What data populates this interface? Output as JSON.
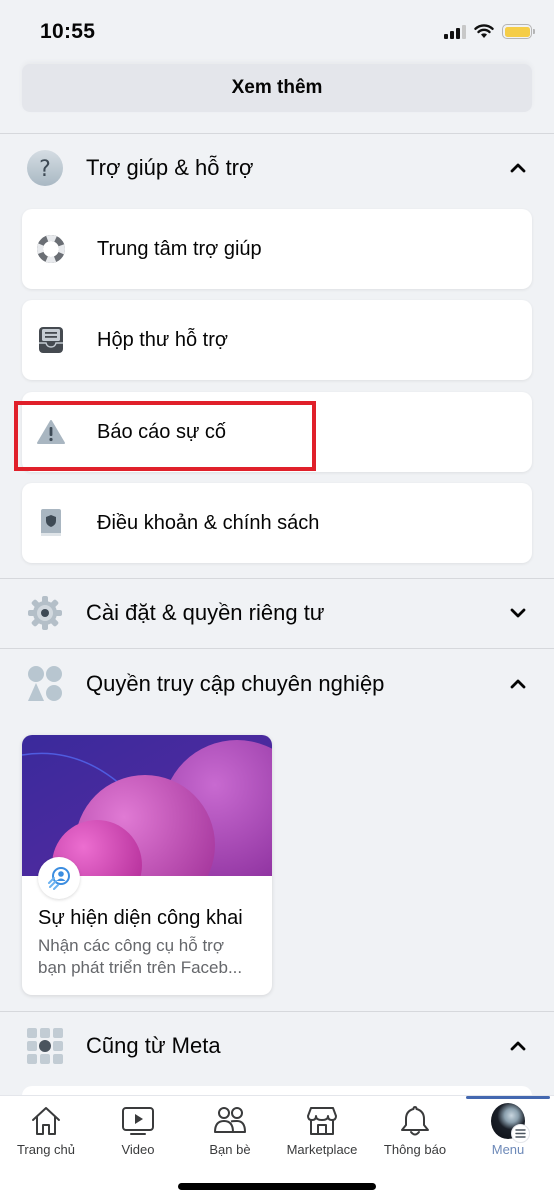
{
  "status_bar": {
    "time": "10:55",
    "signal_bars": 3,
    "signal_bars_total": 4,
    "battery_level": 1.0,
    "battery_color": "#f5cd47"
  },
  "see_more_label": "Xem thêm",
  "sections": {
    "help": {
      "title": "Trợ giúp & hỗ trợ",
      "icon": "question-circle-icon",
      "expanded": true,
      "items": [
        {
          "label": "Trung tâm trợ giúp",
          "icon": "lifebuoy-icon"
        },
        {
          "label": "Hộp thư hỗ trợ",
          "icon": "inbox-tray-icon"
        },
        {
          "label": "Báo cáo sự cố",
          "icon": "warning-triangle-icon",
          "highlighted": true
        },
        {
          "label": "Điều khoản & chính sách",
          "icon": "shield-book-icon"
        }
      ]
    },
    "settings": {
      "title": "Cài đặt & quyền riêng tư",
      "icon": "gear-icon",
      "expanded": false
    },
    "professional": {
      "title": "Quyền truy cập chuyên nghiệp",
      "icon": "people-grid-icon",
      "expanded": true,
      "card": {
        "title": "Sự hiện diện công khai",
        "desc_line1": "Nhận các công cụ hỗ trợ",
        "desc_line2": "bạn phát triển trên Faceb..."
      }
    },
    "meta": {
      "title": "Cũng từ Meta",
      "icon": "app-grid-icon",
      "expanded": true
    }
  },
  "highlight_color": "#e0202a",
  "tab_bar": {
    "active_color": "#4468b0",
    "tabs": [
      {
        "label": "Trang chủ",
        "icon": "home-icon"
      },
      {
        "label": "Video",
        "icon": "video-icon"
      },
      {
        "label": "Bạn bè",
        "icon": "friends-icon"
      },
      {
        "label": "Marketplace",
        "icon": "marketplace-icon"
      },
      {
        "label": "Thông báo",
        "icon": "bell-icon"
      },
      {
        "label": "Menu",
        "icon": "avatar-menu-icon",
        "active": true
      }
    ]
  }
}
